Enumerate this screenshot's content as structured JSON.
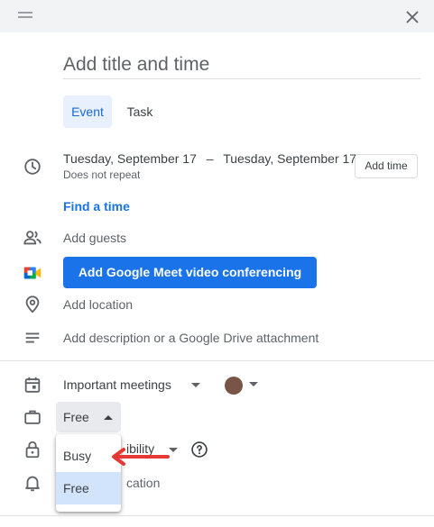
{
  "header": {
    "drag_icon": "drag-handle-icon",
    "close_icon": "close-icon"
  },
  "title": {
    "placeholder": "Add title and time"
  },
  "tabs": [
    {
      "label": "Event",
      "active": true
    },
    {
      "label": "Task",
      "active": false
    }
  ],
  "datetime": {
    "start_date": "Tuesday, September 17",
    "separator": "–",
    "end_date": "Tuesday, September 17",
    "repeat": "Does not repeat",
    "add_time_label": "Add time"
  },
  "find_time": "Find a time",
  "guests_placeholder": "Add guests",
  "meet_button": "Add Google Meet video conferencing",
  "location_placeholder": "Add location",
  "description_placeholder": "Add description or a Google Drive attachment",
  "calendar": {
    "name": "Important meetings",
    "color": "#795548"
  },
  "availability": {
    "selected": "Free",
    "options": [
      "Busy",
      "Free"
    ]
  },
  "visibility": {
    "partial_label": "ibility"
  },
  "notification": {
    "partial_label": "cation"
  },
  "colors": {
    "accent": "#1a73e8",
    "tab_active_bg": "#e8f0fe",
    "selected_option_bg": "#d2e3fc",
    "arrow": "#e53935"
  }
}
